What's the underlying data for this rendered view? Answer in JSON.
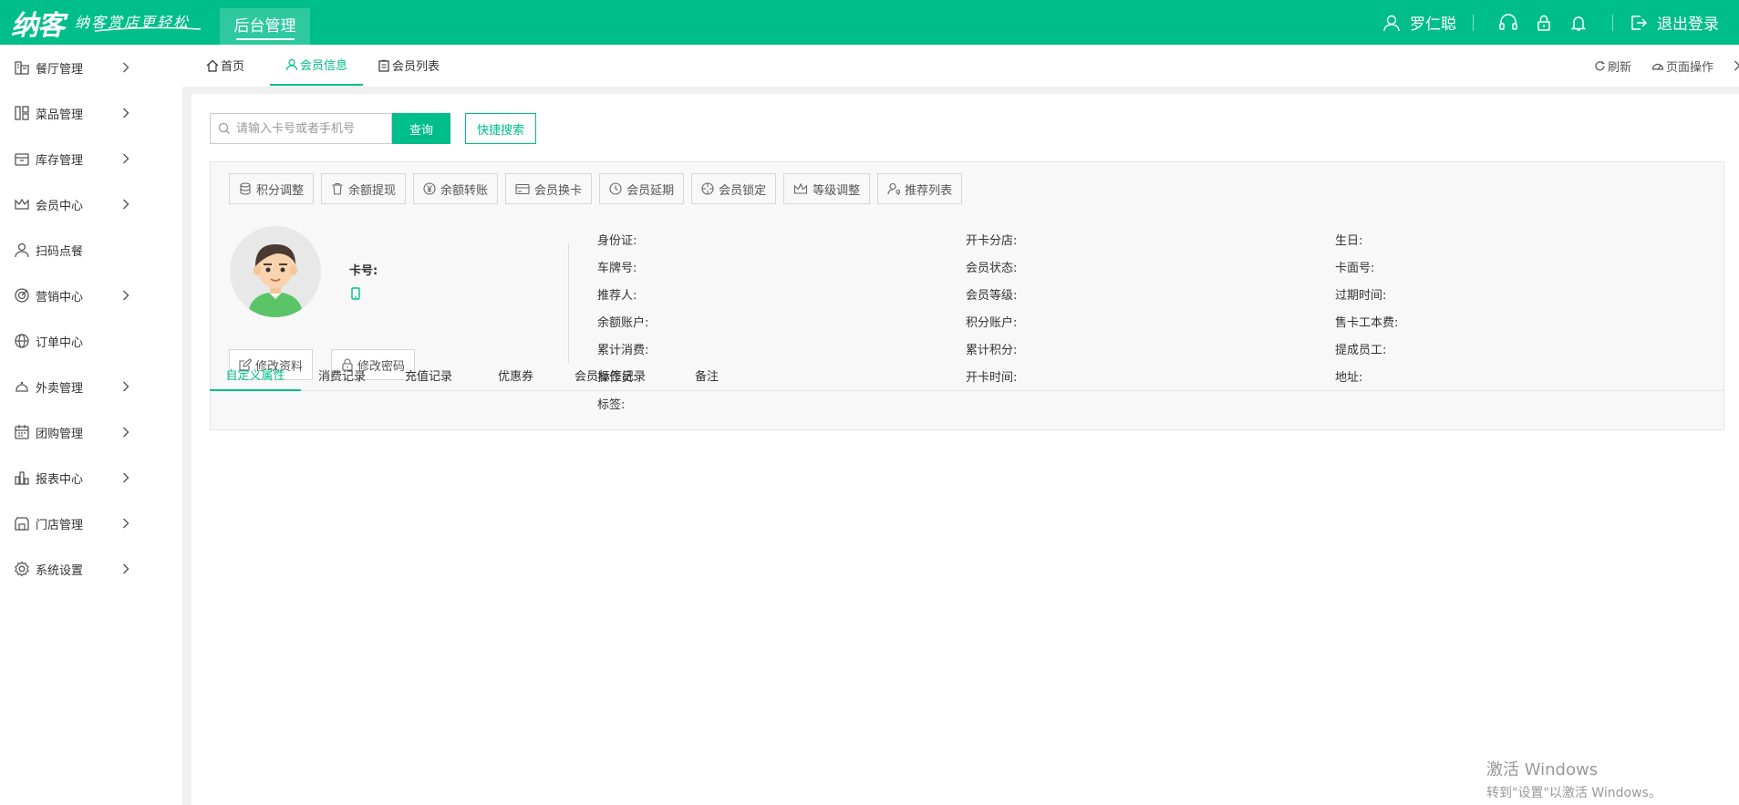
{
  "header": {
    "logo": "纳客",
    "slogan": "纳客赏店更轻松",
    "brand_tab": "后台管理",
    "user_name": "罗仁聪",
    "logout": "退出登录"
  },
  "sidebar": {
    "items": [
      {
        "label": "餐厅管理",
        "icon": "restaurant-icon",
        "arrow": true
      },
      {
        "label": "菜品管理",
        "icon": "dish-icon",
        "arrow": true
      },
      {
        "label": "库存管理",
        "icon": "inventory-icon",
        "arrow": true
      },
      {
        "label": "会员中心",
        "icon": "crown-icon",
        "arrow": true
      },
      {
        "label": "扫码点餐",
        "icon": "user-icon",
        "arrow": false
      },
      {
        "label": "营销中心",
        "icon": "target-icon",
        "arrow": true
      },
      {
        "label": "订单中心",
        "icon": "globe-icon",
        "arrow": false
      },
      {
        "label": "外卖管理",
        "icon": "cloche-icon",
        "arrow": true
      },
      {
        "label": "团购管理",
        "icon": "calendar-icon",
        "arrow": true
      },
      {
        "label": "报表中心",
        "icon": "report-icon",
        "arrow": true
      },
      {
        "label": "门店管理",
        "icon": "store-icon",
        "arrow": true
      },
      {
        "label": "系统设置",
        "icon": "gear-icon",
        "arrow": true
      }
    ]
  },
  "tabs": {
    "home": "首页",
    "member_info": "会员信息",
    "member_list": "会员列表",
    "refresh": "刷新",
    "page_ops": "页面操作"
  },
  "search": {
    "placeholder": "请输入卡号或者手机号",
    "query_button": "查询",
    "quick_search": "快捷搜索"
  },
  "actions": [
    {
      "label": "积分调整",
      "icon": "database-icon"
    },
    {
      "label": "余额提现",
      "icon": "trash-icon"
    },
    {
      "label": "余额转账",
      "icon": "yen-icon"
    },
    {
      "label": "会员换卡",
      "icon": "card-icon"
    },
    {
      "label": "会员延期",
      "icon": "clock-icon"
    },
    {
      "label": "会员锁定",
      "icon": "crosshair-icon"
    },
    {
      "label": "等级调整",
      "icon": "crown-icon"
    },
    {
      "label": "推荐列表",
      "icon": "user-search-icon"
    }
  ],
  "member": {
    "card_no_label": "卡号:",
    "edit_profile": "修改资料",
    "edit_password": "修改密码",
    "fields": {
      "col1": [
        "身份证:",
        "车牌号:",
        "推荐人:",
        "余额账户:",
        "累计消费:",
        "操作员:",
        "标签:"
      ],
      "col2": [
        "开卡分店:",
        "会员状态:",
        "会员等级:",
        "积分账户:",
        "累计积分:",
        "开卡时间:"
      ],
      "col3": [
        "生日:",
        "卡面号:",
        "过期时间:",
        "售卡工本费:",
        "提成员工:",
        "地址:"
      ]
    }
  },
  "bottom_tabs": [
    "自定义属性",
    "消费记录",
    "充值记录",
    "优惠券",
    "会员标签记录",
    "备注"
  ],
  "watermark": {
    "line1": "激活 Windows",
    "line2": "转到\"设置\"以激活 Windows。"
  },
  "colors": {
    "accent": "#00be8a"
  }
}
